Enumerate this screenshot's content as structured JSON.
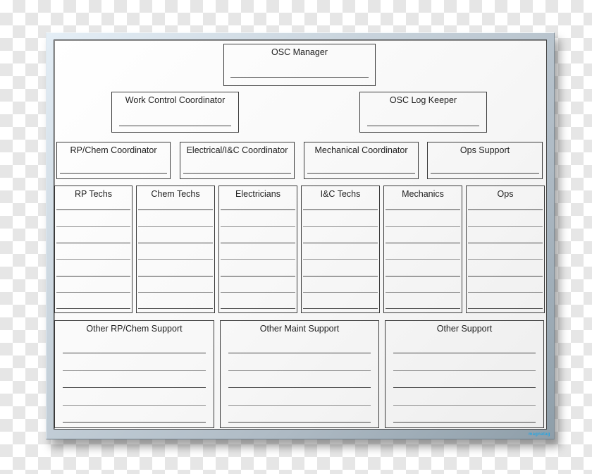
{
  "board": {
    "logo_text": "magnatag",
    "row1": [
      {
        "title": "OSC Manager",
        "entry_lines": 1
      }
    ],
    "row2": [
      {
        "title": "Work Control Coordinator",
        "entry_lines": 1
      },
      {
        "title": "OSC Log Keeper",
        "entry_lines": 1
      }
    ],
    "row3": [
      {
        "title": "RP/Chem Coordinator",
        "entry_lines": 1
      },
      {
        "title": "Electrical/I&C Coordinator",
        "entry_lines": 1
      },
      {
        "title": "Mechanical Coordinator",
        "entry_lines": 1
      },
      {
        "title": "Ops Support",
        "entry_lines": 1
      }
    ],
    "row4": [
      {
        "title": "RP Techs",
        "entry_lines": 7
      },
      {
        "title": "Chem Techs",
        "entry_lines": 7
      },
      {
        "title": "Electricians",
        "entry_lines": 7
      },
      {
        "title": "I&C Techs",
        "entry_lines": 7
      },
      {
        "title": "Mechanics",
        "entry_lines": 7
      },
      {
        "title": "Ops",
        "entry_lines": 7
      }
    ],
    "row5": [
      {
        "title": "Other RP/Chem Support",
        "entry_lines": 5
      },
      {
        "title": "Other Maint Support",
        "entry_lines": 5
      },
      {
        "title": "Other Support",
        "entry_lines": 5
      }
    ]
  }
}
